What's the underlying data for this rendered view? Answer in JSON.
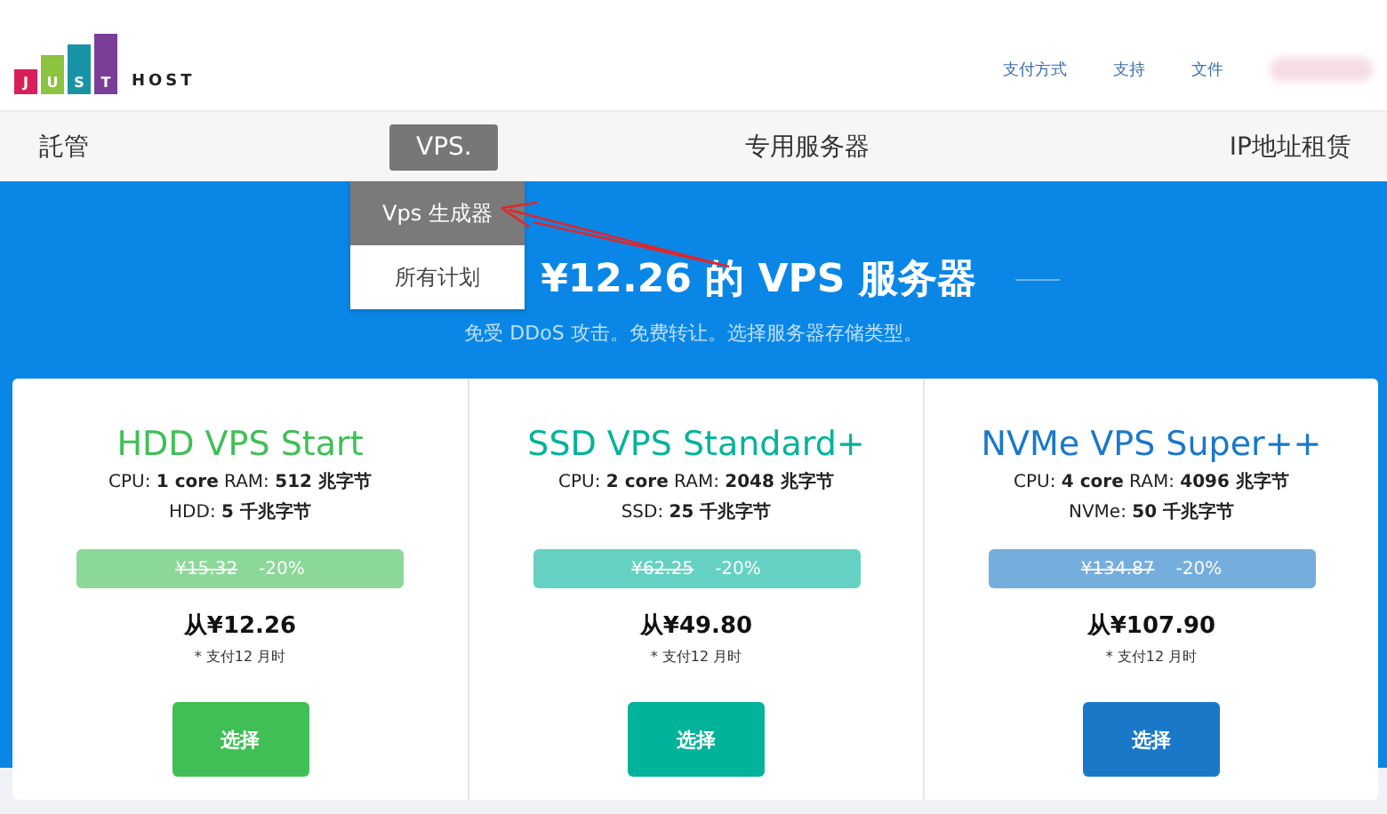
{
  "header": {
    "logo_letters": [
      "J",
      "U",
      "S",
      "T"
    ],
    "logo_word": "HOST",
    "links": [
      "支付方式",
      "支持",
      "文件"
    ]
  },
  "nav": [
    {
      "label": "託管",
      "selected": false
    },
    {
      "label": "VPS.",
      "selected": true
    },
    {
      "label": "专用服务器",
      "selected": false
    },
    {
      "label": "IP地址租赁",
      "selected": false
    }
  ],
  "dropdown": [
    {
      "label": "Vps 生成器",
      "selected": true
    },
    {
      "label": "所有计划",
      "selected": false
    }
  ],
  "hero": {
    "title": "¥12.26 的 VPS 服务器",
    "subtitle": "免受 DDoS 攻击。免费转让。选择服务器存储类型。"
  },
  "plans": [
    {
      "name": "HDD VPS Start",
      "color": "#3fbf55",
      "spec_1": "CPU: **1 core** RAM: **512 兆字节**",
      "spec_2": "HDD: **5 千兆字节**",
      "old_price": "¥15.32",
      "discount": "-20%",
      "price": "从¥12.26",
      "note": "* 支付12 月时",
      "button": "选择"
    },
    {
      "name": "SSD VPS Standard+",
      "color": "#00b39a",
      "spec_1": "CPU: **2 core** RAM: **2048 兆字节**",
      "spec_2": "SSD: **25 千兆字节**",
      "old_price": "¥62.25",
      "discount": "-20%",
      "price": "从¥49.80",
      "note": "* 支付12 月时",
      "button": "选择"
    },
    {
      "name": "NVMe VPS Super++",
      "color": "#1a78c8",
      "spec_1": "CPU: **4 core** RAM: **4096 兆字节**",
      "spec_2": "NVMe: **50 千兆字节**",
      "old_price": "¥134.87",
      "discount": "-20%",
      "price": "从¥107.90",
      "note": "* 支付12 月时",
      "button": "选择"
    }
  ]
}
